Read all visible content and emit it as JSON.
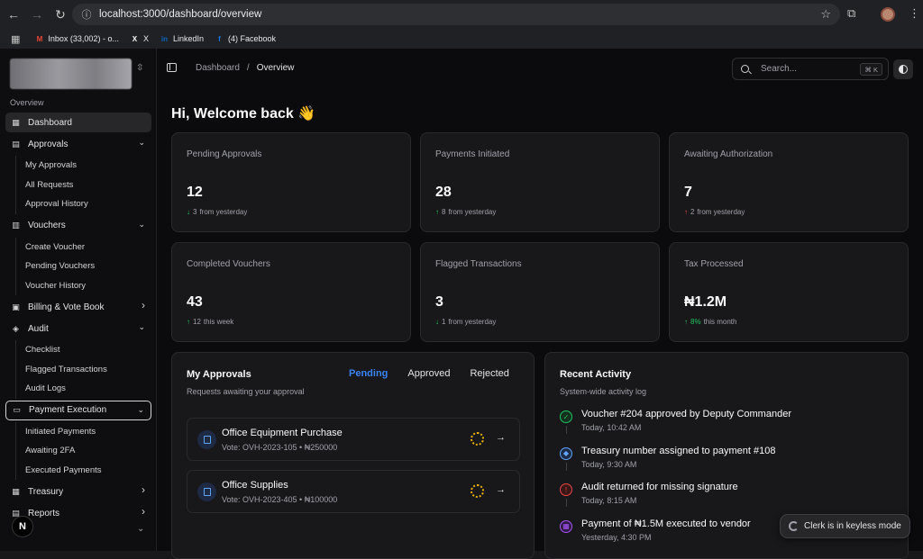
{
  "browser": {
    "url": "localhost:3000/dashboard/overview",
    "bookmarks": [
      {
        "label": "Inbox (33,002) - o...",
        "icon": "gmail-icon",
        "color": "#ea4335",
        "glyph": "M"
      },
      {
        "label": "X",
        "icon": "x-icon",
        "color": "#ffffff",
        "glyph": "X"
      },
      {
        "label": "LinkedIn",
        "icon": "linkedin-icon",
        "color": "#0a66c2",
        "glyph": "in"
      },
      {
        "label": "(4) Facebook",
        "icon": "facebook-icon",
        "color": "#1877f2",
        "glyph": "f"
      }
    ]
  },
  "sidebar": {
    "section_label": "Overview",
    "items": [
      {
        "label": "Dashboard",
        "icon": "grid-icon",
        "glyph": "▦",
        "active": true,
        "expanded": null,
        "children": []
      },
      {
        "label": "Approvals",
        "icon": "clipboard-icon",
        "glyph": "▤",
        "active": false,
        "expanded": true,
        "children": [
          "My Approvals",
          "All Requests",
          "Approval History"
        ]
      },
      {
        "label": "Vouchers",
        "icon": "file-icon",
        "glyph": "▥",
        "active": false,
        "expanded": true,
        "children": [
          "Create Voucher",
          "Pending Vouchers",
          "Voucher History"
        ]
      },
      {
        "label": "Billing & Vote Book",
        "icon": "book-icon",
        "glyph": "▣",
        "active": false,
        "expanded": false,
        "children": []
      },
      {
        "label": "Audit",
        "icon": "shield-icon",
        "glyph": "◈",
        "active": false,
        "expanded": true,
        "children": [
          "Checklist",
          "Flagged Transactions",
          "Audit Logs"
        ]
      },
      {
        "label": "Payment Execution",
        "icon": "credit-card-icon",
        "glyph": "▭",
        "active": false,
        "outlined": true,
        "expanded": true,
        "children": [
          "Initiated Payments",
          "Awaiting 2FA",
          "Executed Payments"
        ]
      },
      {
        "label": "Treasury",
        "icon": "bank-icon",
        "glyph": "▦",
        "active": false,
        "expanded": false,
        "children": []
      },
      {
        "label": "Reports",
        "icon": "chart-icon",
        "glyph": "▤",
        "active": false,
        "expanded": false,
        "children": []
      }
    ],
    "logo_letter": "N"
  },
  "header": {
    "breadcrumb_root": "Dashboard",
    "breadcrumb_sep": "/",
    "breadcrumb_current": "Overview",
    "search_placeholder": "Search...",
    "search_shortcut": "⌘ K"
  },
  "welcome": "Hi, Welcome back 👋",
  "stats": [
    {
      "label": "Pending Approvals",
      "value": "12",
      "direction": "down",
      "color": "green",
      "delta_value": "3",
      "delta_text": "from yesterday"
    },
    {
      "label": "Payments Initiated",
      "value": "28",
      "direction": "up",
      "color": "green",
      "delta_value": "8",
      "delta_text": "from yesterday"
    },
    {
      "label": "Awaiting Authorization",
      "value": "7",
      "direction": "up",
      "color": "red",
      "delta_value": "2",
      "delta_text": "from yesterday"
    },
    {
      "label": "Completed Vouchers",
      "value": "43",
      "direction": "up",
      "color": "green",
      "delta_value": "12",
      "delta_text": "this week"
    },
    {
      "label": "Flagged Transactions",
      "value": "3",
      "direction": "down",
      "color": "green",
      "delta_value": "1",
      "delta_text": "from yesterday"
    },
    {
      "label": "Tax Processed",
      "value": "₦1.2M",
      "direction": "up",
      "color": "green",
      "delta_value": "8%",
      "delta_text": "this month",
      "highlight_pct": true
    }
  ],
  "approvals_panel": {
    "title": "My Approvals",
    "subtitle": "Requests awaiting your approval",
    "tabs": [
      {
        "label": "Pending",
        "active": true
      },
      {
        "label": "Approved",
        "active": false
      },
      {
        "label": "Rejected",
        "active": false
      }
    ],
    "items": [
      {
        "title": "Office Equipment Purchase",
        "meta": "Vote: OVH-2023-105 • ₦250000"
      },
      {
        "title": "Office Supplies",
        "meta": "Vote: OVH-2023-405 • ₦100000"
      }
    ]
  },
  "activity_panel": {
    "title": "Recent Activity",
    "subtitle": "System-wide activity log",
    "items": [
      {
        "title": "Voucher #204 approved by Deputy Commander",
        "time": "Today, 10:42 AM",
        "icon": "check-circle-icon",
        "glyph": "✓",
        "color": "#22c55e",
        "bg": "#12301d"
      },
      {
        "title": "Treasury number assigned to payment #108",
        "time": "Today, 9:30 AM",
        "icon": "tag-icon",
        "glyph": "◆",
        "color": "#60a5fa",
        "bg": "#1e2a44"
      },
      {
        "title": "Audit returned for missing signature",
        "time": "Today, 8:15 AM",
        "icon": "alert-circle-icon",
        "glyph": "!",
        "color": "#ef4444",
        "bg": "#3a1717"
      },
      {
        "title": "Payment of ₦1.5M executed to vendor",
        "time": "Yesterday, 4:30 PM",
        "icon": "bank-icon",
        "glyph": "▦",
        "color": "#a855f7",
        "bg": "#2e1a44"
      }
    ]
  },
  "clerk_badge": "Clerk is in keyless mode"
}
